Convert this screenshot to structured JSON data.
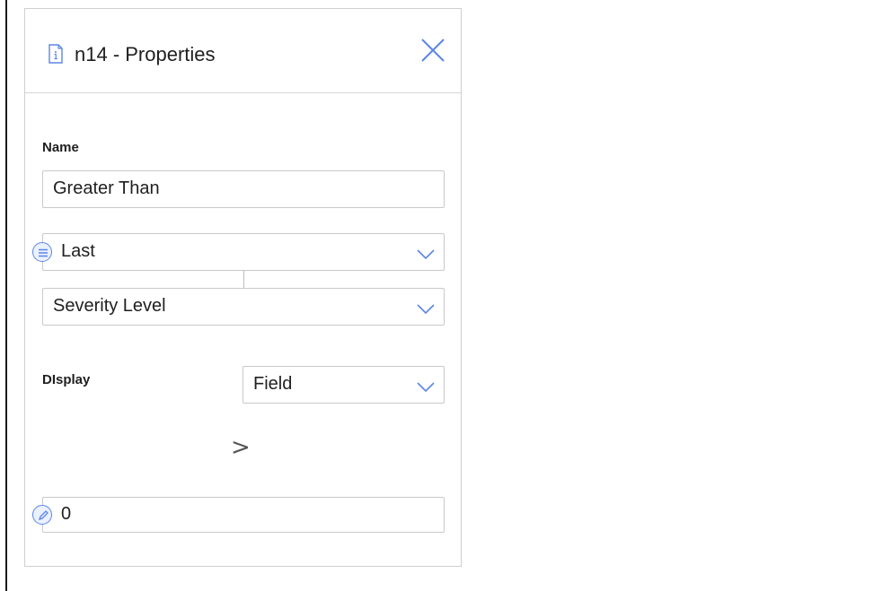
{
  "panel": {
    "title": "n14 - Properties",
    "close_icon": "close-icon",
    "header_icon": "info-document-icon"
  },
  "name_section": {
    "label": "Name",
    "value": "Greater Than"
  },
  "first_dropdown": {
    "value": "Last",
    "badge_icon": "list-icon"
  },
  "second_dropdown": {
    "value": "Severity Level"
  },
  "display_section": {
    "label": "DIsplay",
    "value": "Field"
  },
  "operator": {
    "symbol": ">"
  },
  "value_input": {
    "value": "0",
    "badge_icon": "edit-pencil-icon"
  },
  "colors": {
    "accent": "#5b86e5",
    "border": "#c9c9c9",
    "text": "#1f1f1f"
  }
}
